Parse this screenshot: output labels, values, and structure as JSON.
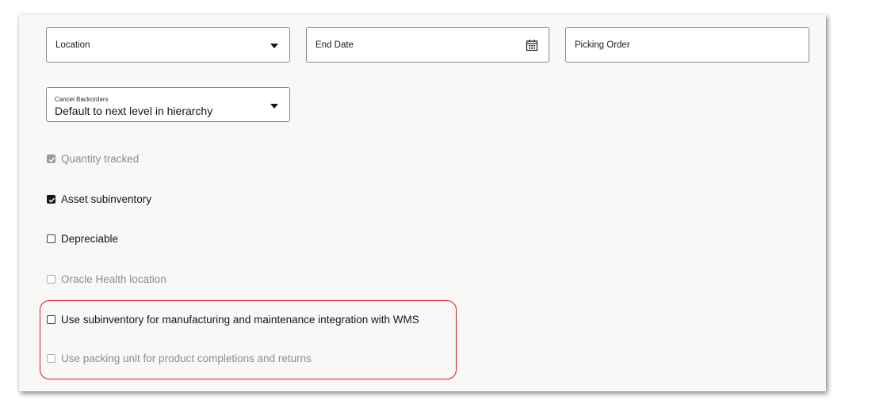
{
  "fields": {
    "location": {
      "label": "Location"
    },
    "end_date": {
      "label": "End Date"
    },
    "picking_order": {
      "label": "Picking Order"
    },
    "cancel_backorders": {
      "label": "Cancel Backorders",
      "value": "Default to next level in hierarchy"
    }
  },
  "checkboxes": [
    {
      "label": "Quantity tracked",
      "checked": true,
      "disabled": true
    },
    {
      "label": "Asset subinventory",
      "checked": true,
      "disabled": false
    },
    {
      "label": "Depreciable",
      "checked": false,
      "disabled": false
    },
    {
      "label": "Oracle Health location",
      "checked": false,
      "disabled": true
    },
    {
      "label": "Use subinventory for manufacturing and maintenance integration with WMS",
      "checked": false,
      "disabled": false
    },
    {
      "label": "Use packing unit for product completions and returns",
      "checked": false,
      "disabled": true
    }
  ],
  "icons": {
    "dropdown": "chevron-down-icon",
    "calendar": "calendar-icon",
    "checkmark": "checkmark-icon"
  },
  "colors": {
    "highlight": "#d01e2a"
  }
}
